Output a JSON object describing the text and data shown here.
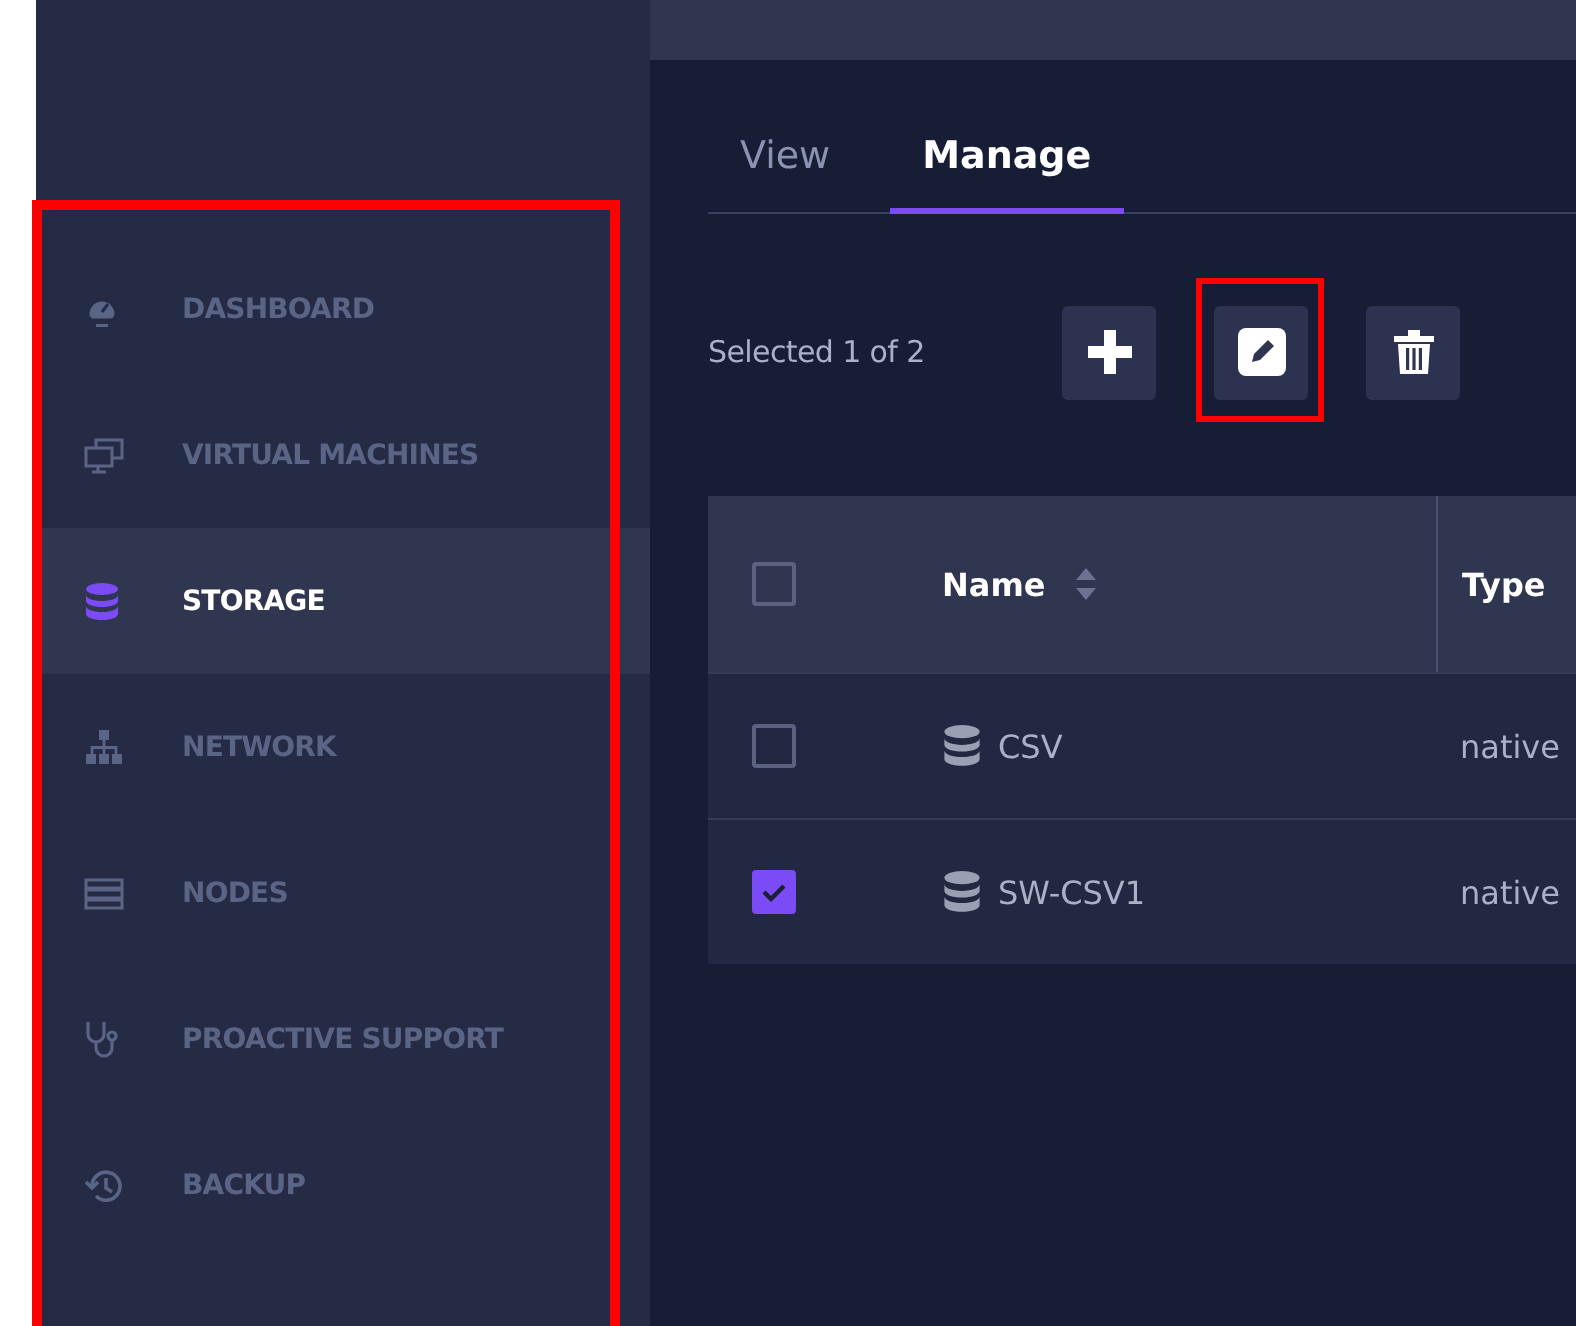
{
  "sidebar": {
    "items": [
      {
        "label": "DASHBOARD",
        "kind": "gauge",
        "selected": false
      },
      {
        "label": "VIRTUAL MACHINES",
        "kind": "monitors",
        "selected": false
      },
      {
        "label": "STORAGE",
        "kind": "database",
        "selected": true
      },
      {
        "label": "NETWORK",
        "kind": "network",
        "selected": false
      },
      {
        "label": "NODES",
        "kind": "server",
        "selected": false
      },
      {
        "label": "PROACTIVE SUPPORT",
        "kind": "stethoscope",
        "selected": false
      },
      {
        "label": "BACKUP",
        "kind": "history",
        "selected": false
      }
    ]
  },
  "tabs": [
    {
      "label": "View",
      "selected": false
    },
    {
      "label": "Manage",
      "selected": true
    }
  ],
  "toolbar": {
    "selection_text": "Selected 1 of 2",
    "buttons": [
      {
        "kind": "add",
        "highlighted": false
      },
      {
        "kind": "edit",
        "highlighted": true
      },
      {
        "kind": "delete",
        "highlighted": false
      }
    ]
  },
  "table": {
    "columns": [
      "Name",
      "Type"
    ],
    "header_checked": false,
    "rows": [
      {
        "name": "CSV",
        "type": "native",
        "checked": false
      },
      {
        "name": "SW-CSV1",
        "type": "native",
        "checked": true
      }
    ]
  },
  "sidebar_highlighted": true
}
